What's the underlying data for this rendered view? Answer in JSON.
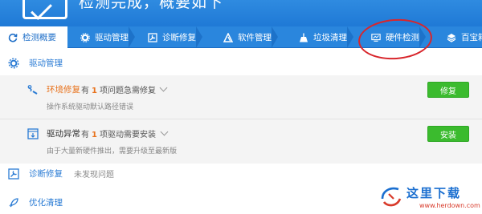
{
  "header": {
    "title": "检测完成，概要如下"
  },
  "tabs": [
    {
      "label": "检测概要",
      "icon": "refresh-icon"
    },
    {
      "label": "驱动管理",
      "icon": "gear-icon"
    },
    {
      "label": "诊断修复",
      "icon": "wrench-icon"
    },
    {
      "label": "软件管理",
      "icon": "triangle-icon"
    },
    {
      "label": "垃圾清理",
      "icon": "broom-icon"
    },
    {
      "label": "硬件检测",
      "icon": "monitor-icon"
    },
    {
      "label": "百宝箱",
      "icon": "box-icon"
    }
  ],
  "sections": {
    "driver": {
      "title": "驱动管理"
    },
    "diagnose": {
      "title": "诊断修复",
      "desc": "未发现问题"
    },
    "cleanup": {
      "title": "优化清理"
    }
  },
  "issues": [
    {
      "label": "环境修复",
      "label_color": "#e8731e",
      "prefix": "有",
      "count": "1",
      "suffix": "项问题急需修复",
      "detail": "操作系统驱动默认路径错误",
      "button": "修复"
    },
    {
      "label": "驱动异常",
      "label_color": "#333333",
      "prefix": "有",
      "count": "1",
      "suffix": "项驱动需要安装",
      "detail": "由于大量新硬件推出，需要升级至最新版",
      "button": "安装"
    }
  ],
  "watermark": {
    "name": "这里下载",
    "url": "www.herdown.com"
  },
  "colors": {
    "accent": "#2a86dd",
    "button": "#3bbb2e",
    "highlight": "#d8262c",
    "warning": "#e8731e"
  }
}
